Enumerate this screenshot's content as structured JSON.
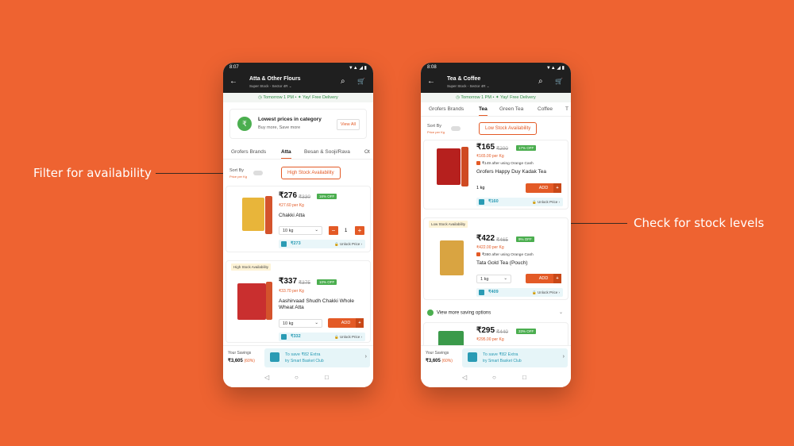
{
  "callouts": {
    "left": "Filter for availability",
    "right": "Check for stock levels"
  },
  "phone1": {
    "status": {
      "time": "8:07",
      "right": "▼▲ ◢ ▮"
    },
    "header": {
      "title": "Atta & Other Flours",
      "subtitle": "Super Stock - Sector 4R",
      "chevron": "⌄"
    },
    "delivery": {
      "left": "Tomorrow 1 PM",
      "sep": "•",
      "right": "Yay! Free Delivery"
    },
    "promo": {
      "title": "Lowest prices in category",
      "sub": "Buy more, Save more",
      "button": "View All"
    },
    "tabs": [
      "Grofers Brands",
      "Atta",
      "Besan & Sooji/Rava",
      "Ot"
    ],
    "sort": {
      "label": "Sort By",
      "sub": "Price per Kg",
      "chip": "High Stock Availability"
    },
    "items": [
      {
        "price": "₹276",
        "mrp": "₹330",
        "off": "16% OFF",
        "per": "₹27.60 per Kg",
        "name": "Chakki Atta",
        "pack": "10 kg",
        "qty": "1",
        "club_price": "₹273",
        "unlock": "🔒 Unlock Price ›"
      },
      {
        "badge": "High Stock Availability",
        "price": "₹337",
        "mrp": "₹375",
        "off": "10% OFF",
        "per": "₹33.70 per Kg",
        "name": "Aashirvaad Shudh Chakki Whole Wheat Atta",
        "pack": "10 kg",
        "add": "ADD",
        "club_price": "₹332",
        "unlock": "🔒 Unlock Price ›"
      }
    ],
    "footer": {
      "label": "Your Savings",
      "value": "₹3,605",
      "pct": "(60%)",
      "save1": "To save ₹82 Extra",
      "save2": "try Smart Basket Club"
    }
  },
  "phone2": {
    "status": {
      "time": "8:08",
      "right": "▼▲ ◢ ▮"
    },
    "header": {
      "title": "Tea & Coffee",
      "subtitle": "Super Stock - Sector 4R",
      "chevron": "⌄"
    },
    "delivery": {
      "left": "Tomorrow 1 PM",
      "sep": "•",
      "right": "Yay! Free Delivery"
    },
    "tabs": [
      "Grofers Brands",
      "Tea",
      "Green Tea",
      "Coffee",
      "T"
    ],
    "sort": {
      "label": "Sort By",
      "sub": "Price per Kg",
      "chip": "Low Stock Availability"
    },
    "items": [
      {
        "price": "₹165",
        "mrp": "₹200",
        "off": "17% OFF",
        "per": "₹165.00 per Kg",
        "note": "₹149 after using Orange Cash",
        "name": "Grofers Happy Duy Kadak Tea",
        "pack": "1 kg",
        "add": "ADD",
        "club_price": "₹160",
        "unlock": "🔒 Unlock Price ›"
      },
      {
        "badge": "Low Stock Availability",
        "price": "₹422",
        "mrp": "₹465",
        "off": "9% OFF",
        "per": "₹422.00 per Kg",
        "note": "₹380 after using Orange Cash",
        "name": "Tata Gold Tea (Pouch)",
        "pack": "1 kg",
        "add": "ADD",
        "club_price": "₹409",
        "unlock": "🔒 Unlock Price ›"
      },
      {
        "price": "₹295",
        "mrp": "₹440",
        "off": "33% OFF",
        "per": "₹295.00 per Kg"
      }
    ],
    "more": "View more saving options",
    "footer": {
      "label": "Your Savings",
      "value": "₹3,605",
      "pct": "(60%)",
      "save1": "To save ₹82 Extra",
      "save2": "try Smart Basket Club"
    }
  },
  "nav": {
    "back": "◁",
    "home": "○",
    "recent": "□"
  },
  "icons": {
    "back": "←",
    "search": "⌕",
    "cart": "🛒",
    "minus": "−",
    "plus": "+",
    "clock": "◷",
    "star": "✦",
    "rupee": "₹"
  },
  "colors": {
    "background": "#ee6331",
    "accent": "#e35a26",
    "header": "#1f1f1f",
    "offer": "#4bae4f",
    "club": "#2a9bb4"
  }
}
